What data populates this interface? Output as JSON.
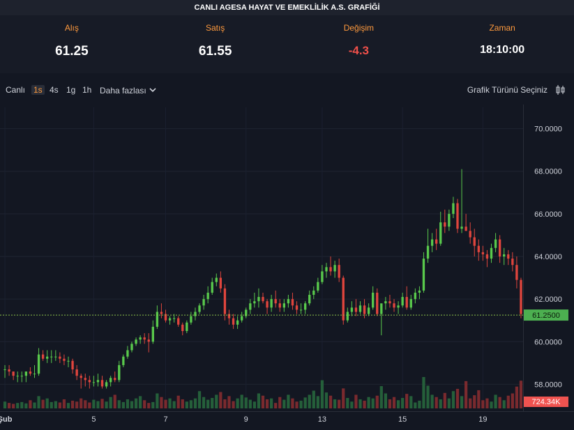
{
  "header": {
    "title": "CANLI AGESA HAYAT VE EMEKLİLİK A.S. GRAFİĞİ"
  },
  "quote": {
    "bid_label": "Alış",
    "bid": "61.25",
    "ask_label": "Satış",
    "ask": "61.55",
    "change_label": "Değişim",
    "change": "-4.3",
    "time_label": "Zaman",
    "time": "18:10:00"
  },
  "toolbar": {
    "live": "Canlı",
    "intervals": [
      "1s",
      "4s",
      "1g",
      "1h"
    ],
    "active_interval": "1s",
    "more": "Daha fazlası",
    "chart_type": "Grafik Türünü Seçiniz"
  },
  "colors": {
    "up": "#26a69a",
    "down": "#ef5350",
    "bg": "#131722",
    "last_price": "#4caf50",
    "accent": "#ff9a3d",
    "volume_label": "#ef5350"
  },
  "chart_data": {
    "type": "candlestick",
    "title": "",
    "x_ticks": [
      {
        "label": "Şub",
        "i": 0
      },
      {
        "label": "5",
        "i": 21
      },
      {
        "label": "7",
        "i": 38
      },
      {
        "label": "9",
        "i": 57
      },
      {
        "label": "13",
        "i": 75
      },
      {
        "label": "15",
        "i": 94
      },
      {
        "label": "19",
        "i": 113
      }
    ],
    "y_ticks": [
      "70.0000",
      "68.0000",
      "66.0000",
      "64.0000",
      "62.0000",
      "60.0000",
      "58.0000"
    ],
    "ylim": [
      57.0,
      71.0
    ],
    "last_price": 61.25,
    "last_price_label": "61.2500",
    "volume_label": "724.34K",
    "ohlc": [
      [
        58.7,
        58.9,
        58.3,
        58.7
      ],
      [
        58.7,
        58.9,
        58.4,
        58.6
      ],
      [
        58.6,
        58.6,
        58.2,
        58.4
      ],
      [
        58.4,
        58.6,
        58.1,
        58.4
      ],
      [
        58.4,
        58.6,
        58.1,
        58.4
      ],
      [
        58.4,
        58.6,
        58.1,
        58.6
      ],
      [
        58.6,
        58.8,
        58.4,
        58.5
      ],
      [
        58.5,
        58.9,
        58.3,
        58.5
      ],
      [
        58.5,
        59.7,
        58.4,
        59.4
      ],
      [
        59.4,
        59.6,
        59.1,
        59.2
      ],
      [
        59.2,
        59.6,
        59.0,
        59.3
      ],
      [
        59.3,
        59.6,
        59.0,
        59.3
      ],
      [
        59.3,
        59.6,
        59.1,
        59.3
      ],
      [
        59.3,
        59.5,
        59.0,
        59.2
      ],
      [
        59.2,
        59.4,
        58.9,
        59.1
      ],
      [
        59.1,
        59.3,
        58.8,
        59.1
      ],
      [
        59.1,
        59.2,
        58.5,
        58.7
      ],
      [
        58.7,
        58.9,
        58.2,
        58.4
      ],
      [
        58.4,
        58.5,
        57.8,
        58.3
      ],
      [
        58.3,
        58.5,
        57.9,
        58.2
      ],
      [
        58.2,
        58.4,
        57.8,
        58.1
      ],
      [
        58.1,
        58.4,
        57.9,
        58.1
      ],
      [
        58.1,
        58.5,
        57.9,
        58.2
      ],
      [
        58.2,
        58.4,
        57.8,
        57.9
      ],
      [
        57.9,
        58.2,
        57.8,
        58.1
      ],
      [
        58.1,
        58.4,
        57.9,
        58.3
      ],
      [
        58.3,
        58.6,
        58.1,
        58.2
      ],
      [
        58.2,
        59.1,
        58.1,
        58.9
      ],
      [
        58.9,
        59.4,
        58.8,
        59.3
      ],
      [
        59.3,
        59.8,
        59.2,
        59.6
      ],
      [
        59.6,
        60.0,
        59.5,
        59.9
      ],
      [
        59.9,
        60.2,
        59.8,
        60.1
      ],
      [
        60.1,
        60.3,
        59.9,
        60.2
      ],
      [
        60.2,
        60.4,
        59.9,
        60.1
      ],
      [
        60.1,
        60.4,
        59.5,
        60.0
      ],
      [
        60.0,
        61.0,
        59.9,
        60.7
      ],
      [
        60.7,
        61.7,
        60.6,
        61.4
      ],
      [
        61.4,
        61.8,
        61.1,
        61.3
      ],
      [
        61.3,
        61.5,
        60.9,
        61.0
      ],
      [
        61.0,
        61.2,
        60.8,
        61.1
      ],
      [
        61.1,
        61.3,
        60.9,
        61.1
      ],
      [
        61.1,
        61.2,
        60.7,
        60.8
      ],
      [
        60.8,
        60.9,
        60.3,
        60.5
      ],
      [
        60.5,
        61.0,
        60.4,
        60.9
      ],
      [
        60.9,
        61.4,
        60.8,
        61.2
      ],
      [
        61.2,
        61.6,
        61.0,
        61.4
      ],
      [
        61.4,
        61.8,
        61.3,
        61.7
      ],
      [
        61.7,
        62.2,
        61.5,
        62.0
      ],
      [
        62.0,
        62.6,
        61.8,
        62.3
      ],
      [
        62.3,
        63.0,
        62.2,
        62.8
      ],
      [
        62.8,
        63.2,
        62.6,
        63.0
      ],
      [
        63.0,
        63.3,
        62.3,
        62.5
      ],
      [
        62.5,
        62.7,
        61.0,
        61.3
      ],
      [
        61.3,
        61.5,
        60.8,
        61.1
      ],
      [
        61.1,
        61.3,
        60.6,
        60.8
      ],
      [
        60.8,
        61.2,
        60.6,
        61.0
      ],
      [
        61.0,
        61.4,
        60.9,
        61.2
      ],
      [
        61.2,
        61.6,
        61.1,
        61.5
      ],
      [
        61.5,
        62.0,
        61.3,
        61.8
      ],
      [
        61.8,
        62.3,
        61.6,
        61.9
      ],
      [
        61.9,
        62.5,
        61.6,
        62.1
      ],
      [
        62.1,
        62.3,
        61.8,
        61.9
      ],
      [
        61.9,
        62.0,
        61.3,
        61.6
      ],
      [
        61.6,
        62.2,
        61.4,
        62.0
      ],
      [
        62.0,
        62.4,
        61.6,
        61.8
      ],
      [
        61.8,
        62.0,
        61.4,
        61.6
      ],
      [
        61.6,
        62.0,
        61.4,
        61.8
      ],
      [
        61.8,
        62.2,
        61.6,
        62.0
      ],
      [
        62.0,
        62.3,
        61.5,
        61.7
      ],
      [
        61.7,
        61.9,
        61.3,
        61.5
      ],
      [
        61.5,
        61.8,
        61.3,
        61.5
      ],
      [
        61.5,
        61.9,
        61.3,
        61.8
      ],
      [
        61.8,
        62.4,
        61.7,
        62.2
      ],
      [
        62.2,
        62.6,
        62.0,
        62.4
      ],
      [
        62.4,
        63.0,
        62.3,
        62.8
      ],
      [
        62.8,
        63.6,
        62.7,
        63.3
      ],
      [
        63.3,
        63.7,
        63.0,
        63.5
      ],
      [
        63.5,
        64.0,
        63.1,
        63.3
      ],
      [
        63.3,
        63.8,
        63.0,
        63.6
      ],
      [
        63.6,
        63.9,
        62.8,
        63.0
      ],
      [
        63.0,
        63.1,
        60.8,
        61.0
      ],
      [
        61.0,
        61.6,
        60.9,
        61.4
      ],
      [
        61.4,
        61.9,
        61.2,
        61.6
      ],
      [
        61.6,
        62.0,
        61.2,
        61.4
      ],
      [
        61.4,
        61.9,
        61.3,
        61.7
      ],
      [
        61.7,
        62.0,
        61.1,
        61.3
      ],
      [
        61.3,
        61.8,
        61.2,
        61.6
      ],
      [
        61.6,
        62.6,
        61.5,
        62.3
      ],
      [
        62.3,
        62.5,
        61.2,
        61.3
      ],
      [
        61.3,
        61.5,
        60.3,
        61.8
      ],
      [
        61.8,
        62.1,
        61.5,
        61.9
      ],
      [
        61.9,
        62.2,
        61.6,
        61.8
      ],
      [
        61.8,
        62.0,
        61.4,
        61.6
      ],
      [
        61.6,
        61.9,
        61.3,
        61.7
      ],
      [
        61.7,
        62.3,
        61.6,
        62.1
      ],
      [
        62.1,
        62.6,
        61.5,
        61.6
      ],
      [
        61.6,
        62.2,
        61.5,
        62.0
      ],
      [
        62.0,
        62.5,
        61.8,
        62.3
      ],
      [
        62.3,
        62.6,
        62.0,
        62.4
      ],
      [
        62.4,
        64.2,
        62.3,
        63.9
      ],
      [
        63.9,
        65.3,
        63.7,
        64.5
      ],
      [
        64.5,
        65.1,
        64.2,
        64.8
      ],
      [
        64.8,
        65.3,
        64.3,
        64.6
      ],
      [
        64.6,
        66.1,
        64.5,
        65.6
      ],
      [
        65.6,
        66.2,
        65.1,
        65.4
      ],
      [
        65.4,
        66.2,
        65.2,
        66.0
      ],
      [
        66.0,
        66.8,
        65.8,
        66.5
      ],
      [
        66.5,
        66.7,
        65.1,
        65.3
      ],
      [
        65.3,
        68.1,
        65.1,
        65.4
      ],
      [
        65.4,
        66.0,
        65.2,
        65.2
      ],
      [
        65.2,
        65.6,
        64.6,
        64.9
      ],
      [
        64.9,
        65.3,
        64.0,
        64.5
      ],
      [
        64.5,
        64.8,
        63.8,
        64.2
      ],
      [
        64.2,
        64.5,
        63.8,
        64.1
      ],
      [
        64.1,
        64.3,
        63.5,
        63.9
      ],
      [
        63.9,
        64.6,
        63.7,
        64.4
      ],
      [
        64.4,
        65.1,
        64.2,
        64.8
      ],
      [
        64.8,
        65.0,
        63.7,
        64.0
      ],
      [
        64.0,
        64.4,
        63.6,
        64.1
      ],
      [
        64.1,
        64.3,
        63.6,
        63.9
      ],
      [
        63.9,
        64.2,
        63.3,
        63.6
      ],
      [
        63.6,
        64.0,
        62.5,
        62.9
      ],
      [
        62.9,
        63.0,
        61.1,
        61.3
      ]
    ],
    "volume": [
      15,
      12,
      10,
      12,
      14,
      11,
      18,
      13,
      27,
      19,
      22,
      14,
      16,
      13,
      20,
      12,
      17,
      15,
      22,
      18,
      13,
      19,
      16,
      21,
      15,
      25,
      30,
      18,
      14,
      20,
      16,
      22,
      27,
      18,
      12,
      14,
      33,
      25,
      19,
      22,
      16,
      28,
      20,
      15,
      18,
      22,
      38,
      25,
      19,
      23,
      30,
      36,
      20,
      27,
      16,
      22,
      30,
      24,
      19,
      15,
      33,
      28,
      20,
      22,
      12,
      25,
      19,
      30,
      22,
      15,
      17,
      24,
      30,
      39,
      27,
      62,
      35,
      28,
      20,
      19,
      44,
      23,
      15,
      30,
      20,
      17,
      25,
      22,
      28,
      49,
      33,
      20,
      25,
      18,
      23,
      32,
      27,
      13,
      17,
      69,
      50,
      30,
      25,
      20,
      34,
      22,
      38,
      43,
      27,
      60,
      22,
      29,
      40,
      18,
      22,
      15,
      30,
      25,
      18,
      28,
      33,
      48,
      61
    ]
  }
}
